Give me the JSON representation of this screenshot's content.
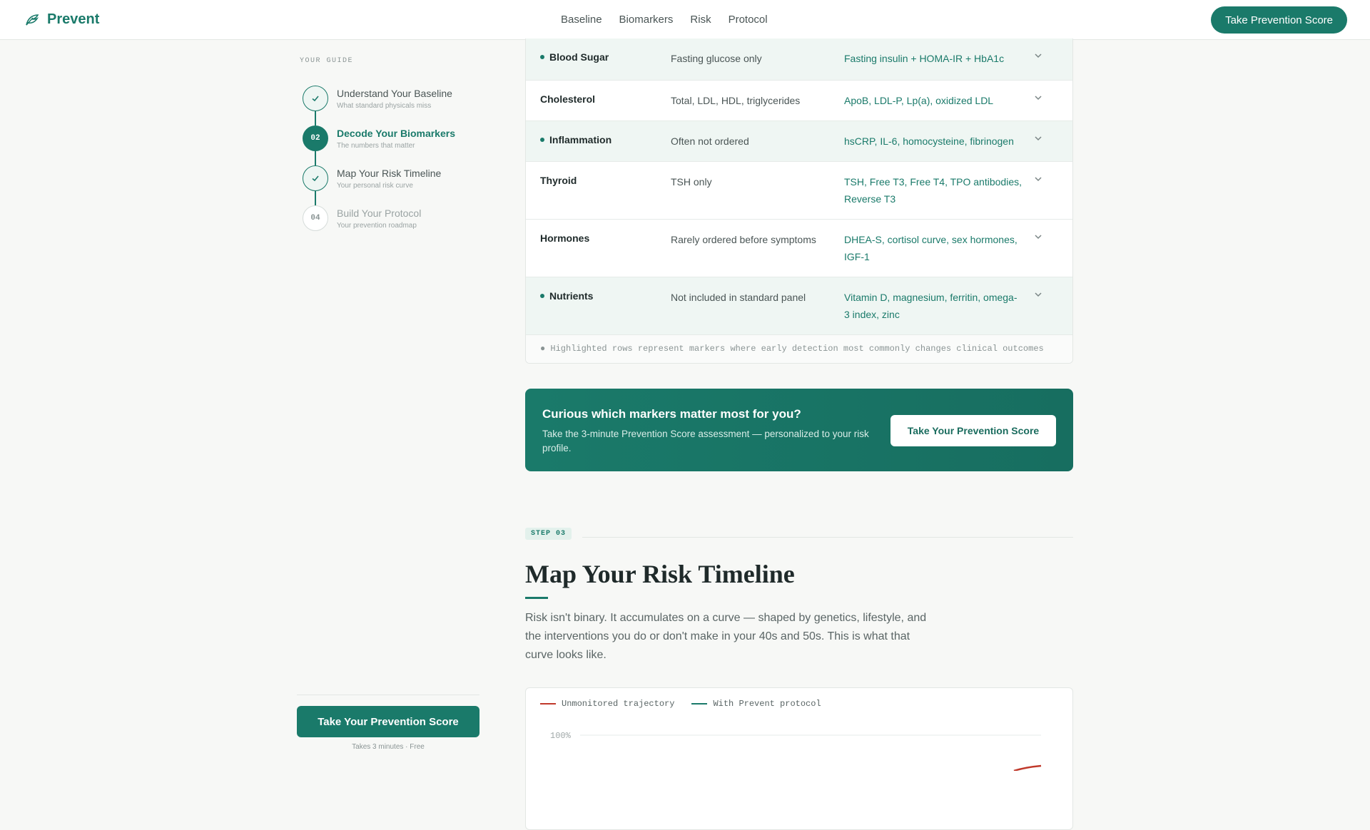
{
  "header": {
    "brand": "Prevent",
    "nav": [
      "Baseline",
      "Biomarkers",
      "Risk",
      "Protocol"
    ],
    "cta": "Take Prevention Score"
  },
  "sidebar": {
    "label": "YOUR GUIDE",
    "steps": [
      {
        "marker": "check",
        "title": "Understand Your Baseline",
        "subtitle": "What standard physicals miss",
        "state": "done"
      },
      {
        "marker": "02",
        "title": "Decode Your Biomarkers",
        "subtitle": "The numbers that matter",
        "state": "active"
      },
      {
        "marker": "check",
        "title": "Map Your Risk Timeline",
        "subtitle": "Your personal risk curve",
        "state": "done"
      },
      {
        "marker": "04",
        "title": "Build Your Protocol",
        "subtitle": "Your prevention roadmap",
        "state": "pending"
      }
    ],
    "cta": "Take Your Prevention Score",
    "cta_note": "Takes 3 minutes · Free"
  },
  "table": {
    "rows": [
      {
        "name": "Blood Sugar",
        "standard": "Fasting glucose only",
        "advanced": "Fasting insulin + HOMA-IR + HbA1c",
        "highlight": true
      },
      {
        "name": "Cholesterol",
        "standard": "Total, LDL, HDL, triglycerides",
        "advanced": "ApoB, LDL-P, Lp(a), oxidized LDL",
        "highlight": false
      },
      {
        "name": "Inflammation",
        "standard": "Often not ordered",
        "advanced": "hsCRP, IL-6, homocysteine, fibrinogen",
        "highlight": true
      },
      {
        "name": "Thyroid",
        "standard": "TSH only",
        "advanced": "TSH, Free T3, Free T4, TPO antibodies, Reverse T3",
        "highlight": false
      },
      {
        "name": "Hormones",
        "standard": "Rarely ordered before symptoms",
        "advanced": "DHEA-S, cortisol curve, sex hormones, IGF-1",
        "highlight": false
      },
      {
        "name": "Nutrients",
        "standard": "Not included in standard panel",
        "advanced": "Vitamin D, magnesium, ferritin, omega-3 index, zinc",
        "highlight": true
      }
    ],
    "note": "● Highlighted rows represent markers where early detection most commonly changes clinical outcomes"
  },
  "cta_box": {
    "title": "Curious which markers matter most for you?",
    "description": "Take the 3-minute Prevention Score assessment — personalized to your risk profile.",
    "button": "Take Your Prevention Score"
  },
  "section": {
    "tag": "STEP 03",
    "title": "Map Your Risk Timeline",
    "lead": "Risk isn't binary. It accumulates on a curve — shaped by genetics, lifestyle, and the interventions you do or don't make in your 40s and 50s. This is what that curve looks like."
  },
  "chart": {
    "legend": [
      {
        "label": "Unmonitored trajectory",
        "color": "#c0392b"
      },
      {
        "label": "With Prevent protocol",
        "color": "#1a7a6a"
      }
    ],
    "y_tick_top": "100%"
  },
  "colors": {
    "accent": "#1a7a6a",
    "risk": "#c0392b"
  }
}
